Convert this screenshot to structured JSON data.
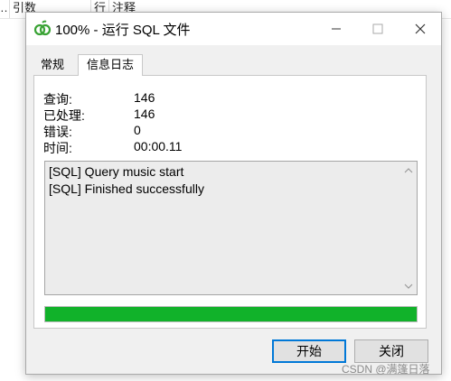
{
  "background": {
    "cells": [
      "…",
      "引数",
      "行",
      "注释"
    ]
  },
  "window": {
    "title": "100% - 运行 SQL 文件",
    "icon": "dolphin-app-icon",
    "controls": [
      "minimize-icon",
      "maximize-icon",
      "close-icon"
    ]
  },
  "tabs": [
    {
      "label": "常规",
      "active": false
    },
    {
      "label": "信息日志",
      "active": true
    }
  ],
  "stats": [
    {
      "label": "查询:",
      "value": "146"
    },
    {
      "label": "已处理:",
      "value": "146"
    },
    {
      "label": "错误:",
      "value": "0"
    },
    {
      "label": "时间:",
      "value": "00:00.11"
    }
  ],
  "log": {
    "lines": [
      "[SQL] Query music start",
      "[SQL] Finished successfully"
    ]
  },
  "progress": {
    "fraction": 1.0,
    "color": "#11b22a"
  },
  "buttons": {
    "start": "开始",
    "close": "关闭"
  },
  "watermark": "CSDN @满篷日落"
}
